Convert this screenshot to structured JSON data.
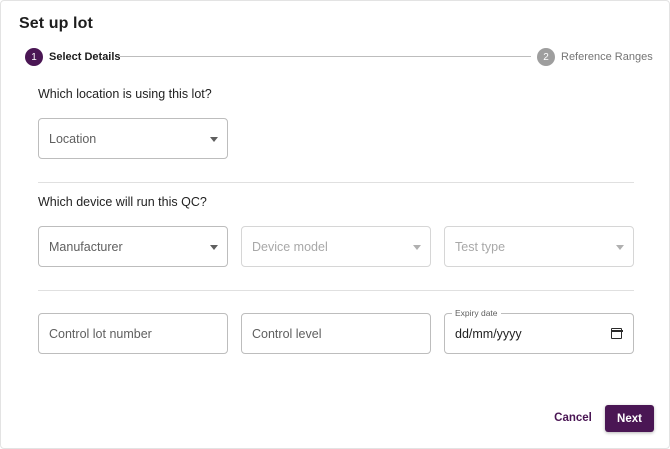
{
  "dialog": {
    "title": "Set up lot"
  },
  "stepper": {
    "steps": [
      {
        "number": "1",
        "label": "Select Details",
        "state": "active"
      },
      {
        "number": "2",
        "label": "Reference Ranges",
        "state": "inactive"
      }
    ]
  },
  "sections": {
    "location_question": "Which location is using this lot?",
    "device_question": "Which device will run this QC?"
  },
  "fields": {
    "location": {
      "label": "Location"
    },
    "manufacturer": {
      "label": "Manufacturer"
    },
    "device_model": {
      "label": "Device model",
      "disabled": true
    },
    "test_type": {
      "label": "Test type",
      "disabled": true
    },
    "control_lot_number": {
      "label": "Control lot number"
    },
    "control_level": {
      "label": "Control level"
    },
    "expiry_date": {
      "label": "Expiry date",
      "value": "dd/mm/yyyy"
    }
  },
  "actions": {
    "cancel_label": "Cancel",
    "next_label": "Next"
  },
  "colors": {
    "accent": "#4a1654",
    "inactive_step": "#9e9e9e",
    "border": "#bdbdbd"
  },
  "icons": {
    "select_arrow": "arrow-drop-down-icon",
    "calendar": "calendar-icon"
  }
}
